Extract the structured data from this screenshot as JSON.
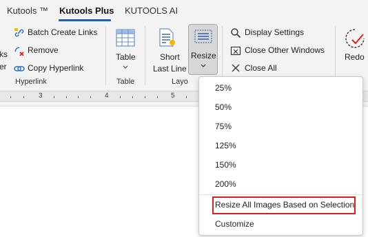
{
  "tabs": [
    {
      "label": "Kutools ™"
    },
    {
      "label": "Kutools Plus"
    },
    {
      "label": "KUTOOLS AI"
    }
  ],
  "ribbon": {
    "hyperlink_group": {
      "partial_lines": [
        "ks",
        "er"
      ],
      "batch_create_links": "Batch Create Links",
      "remove": "Remove",
      "copy_hyperlink": "Copy Hyperlink",
      "group_label": "Hyperlink"
    },
    "table_group": {
      "table_button": "Table",
      "group_label": "Table"
    },
    "layout_group": {
      "short_last_line_1": "Short",
      "short_last_line_2": "Last Line",
      "resize_button": "Resize",
      "group_label": "Layo"
    },
    "window_group": {
      "display_settings": "Display Settings",
      "close_other_windows": "Close Other Windows",
      "close_all": "Close All"
    },
    "redo_button": "Redo"
  },
  "ruler": {
    "numbers": [
      "3",
      "4",
      "5"
    ]
  },
  "resize_menu": {
    "items": [
      "25%",
      "50%",
      "75%",
      "125%",
      "150%",
      "200%",
      "Resize All Images Based on Selection",
      "Customize"
    ]
  },
  "colors": {
    "accent": "#1f5fb8",
    "highlight_border": "#e01b1b",
    "ribbon_bg": "#f3f3f3"
  }
}
